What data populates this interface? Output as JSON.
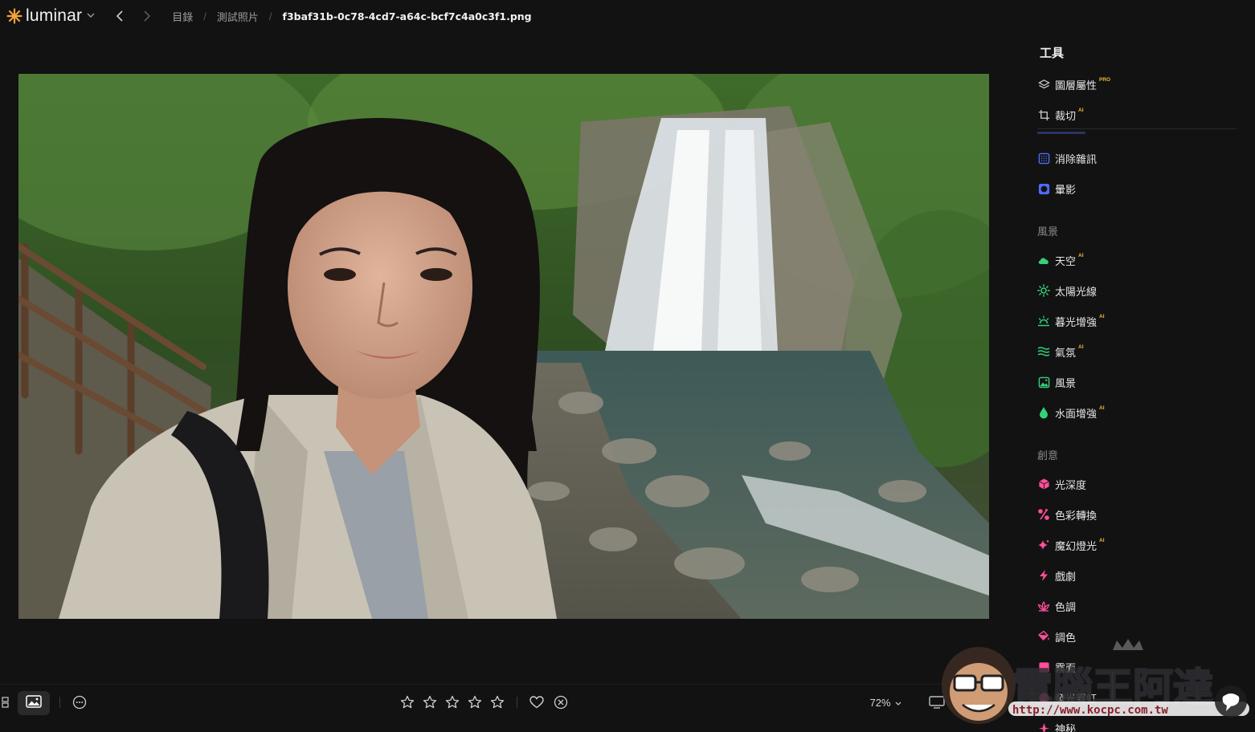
{
  "app": {
    "name": "luminar"
  },
  "breadcrumb": {
    "items": [
      "目錄",
      "測試照片"
    ],
    "current": "f3baf31b-0c78-4cd7-a64c-bcf7c4a0c3f1.png"
  },
  "panel": {
    "title": "工具",
    "tools_top": [
      {
        "label": "圖層屬性",
        "badge": "PRO",
        "icon": "layers-icon"
      },
      {
        "label": "裁切",
        "badge": "AI",
        "icon": "crop-icon"
      }
    ],
    "tools_basic": [
      {
        "label": "消除雜訊",
        "badge": "",
        "icon": "noise-icon"
      },
      {
        "label": "暈影",
        "badge": "",
        "icon": "vignette-icon"
      }
    ],
    "section_landscape": "風景",
    "tools_landscape": [
      {
        "label": "天空",
        "badge": "AI",
        "icon": "cloud-icon"
      },
      {
        "label": "太陽光線",
        "badge": "",
        "icon": "sun-icon"
      },
      {
        "label": "暮光增強",
        "badge": "AI",
        "icon": "sunset-icon"
      },
      {
        "label": "氣氛",
        "badge": "AI",
        "icon": "waves-icon"
      },
      {
        "label": "風景",
        "badge": "",
        "icon": "landscape-icon"
      },
      {
        "label": "水面增強",
        "badge": "AI",
        "icon": "drop-icon"
      }
    ],
    "section_creative": "創意",
    "tools_creative": [
      {
        "label": "光深度",
        "badge": "",
        "icon": "cube-icon"
      },
      {
        "label": "色彩轉換",
        "badge": "",
        "icon": "color-transfer-icon"
      },
      {
        "label": "魔幻燈光",
        "badge": "AI",
        "icon": "sparkle-icon"
      },
      {
        "label": "戲劇",
        "badge": "",
        "icon": "bolt-icon"
      },
      {
        "label": "色調",
        "badge": "",
        "icon": "lotus-icon"
      },
      {
        "label": "調色",
        "badge": "",
        "icon": "bucket-icon"
      },
      {
        "label": "霧面",
        "badge": "",
        "icon": "matte-icon"
      },
      {
        "label": "發光霓虹",
        "badge": "",
        "icon": "neon-icon"
      },
      {
        "label": "神秘",
        "badge": "",
        "icon": "mystic-icon"
      }
    ]
  },
  "bottombar": {
    "zoom": "72%",
    "rating": {
      "stars_total": 5,
      "stars_filled": 0
    }
  },
  "colors": {
    "background": "#121212",
    "accent_blue": "#4f6bff",
    "landscape_green": "#34d17a",
    "creative_pink": "#ff4f9a",
    "badge_gold": "#f4b53a"
  },
  "watermark": {
    "title": "電腦王阿達",
    "url": "http://www.kocpc.com.tw"
  }
}
